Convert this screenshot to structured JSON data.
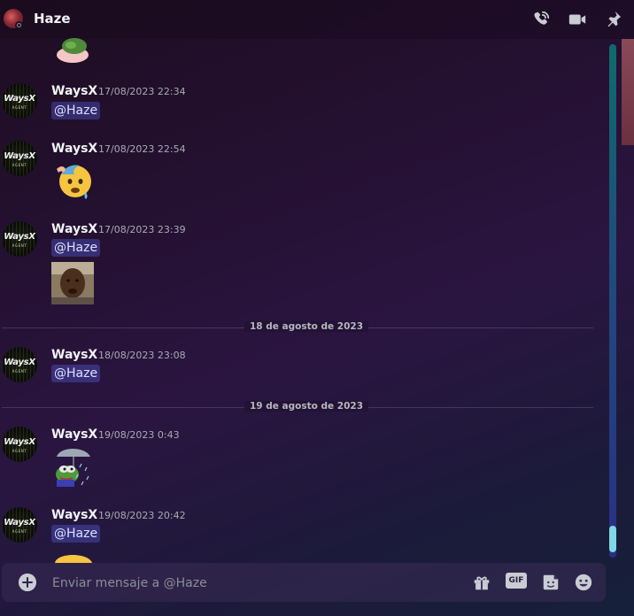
{
  "header": {
    "title": "Haze",
    "icons": [
      "phone-call-icon",
      "video-camera-icon",
      "pin-icon"
    ]
  },
  "author_avatar": {
    "logo_text": "WaysX",
    "sub_text": "AGENT"
  },
  "messages": [
    {
      "author": "WaysX",
      "timestamp": "17/08/2023 22:34",
      "mention": "@Haze"
    },
    {
      "author": "WaysX",
      "timestamp": "17/08/2023 22:54",
      "attachment": "sweating-emoji"
    },
    {
      "author": "WaysX",
      "timestamp": "17/08/2023 23:39",
      "mention": "@Haze",
      "attachment": "photo-thumbnail"
    },
    {
      "author": "WaysX",
      "timestamp": "18/08/2023 23:08",
      "mention": "@Haze"
    },
    {
      "author": "WaysX",
      "timestamp": "19/08/2023 0:43",
      "attachment": "frog-umbrella-sticker"
    },
    {
      "author": "WaysX",
      "timestamp": "19/08/2023 20:42",
      "mention": "@Haze",
      "attachment": "yellow-emoji"
    }
  ],
  "dividers": [
    {
      "label": "18 de agosto de 2023"
    },
    {
      "label": "19 de agosto de 2023"
    }
  ],
  "composer": {
    "placeholder": "Enviar mensaje a @Haze",
    "gif_label": "GIF",
    "icons": [
      "add-icon",
      "gift-icon",
      "gif-icon",
      "sticker-icon",
      "emoji-icon"
    ]
  },
  "colors": {
    "mention_bg": "#5865f2",
    "scroll_thumb": "#7fd8e6",
    "text_primary": "#f2f3f5"
  }
}
